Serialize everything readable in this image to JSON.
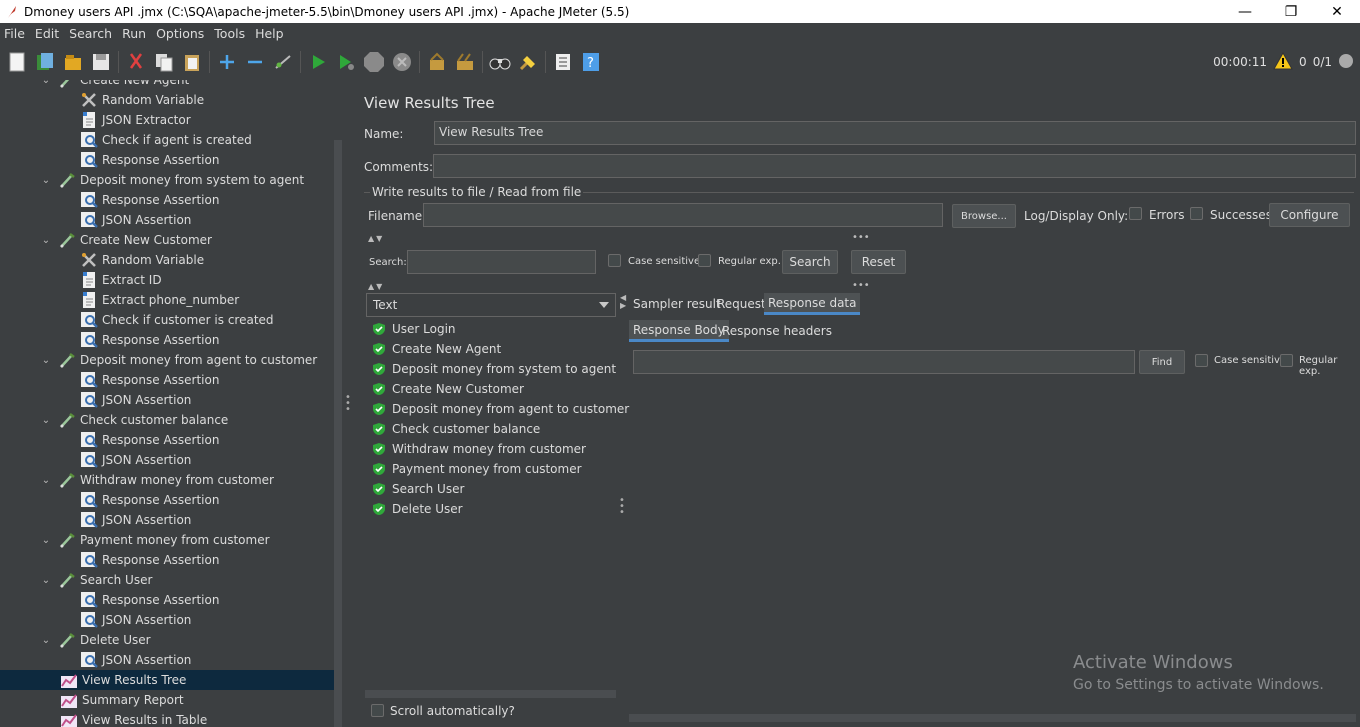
{
  "window": {
    "title": "Dmoney users API .jmx (C:\\SQA\\apache-jmeter-5.5\\bin\\Dmoney users API .jmx) - Apache JMeter (5.5)",
    "minimize": "—",
    "maximize": "❐",
    "close": "✕"
  },
  "menu": {
    "file": "File",
    "edit": "Edit",
    "search": "Search",
    "run": "Run",
    "options": "Options",
    "tools": "Tools",
    "help": "Help"
  },
  "toolbar": {
    "elapsed": "00:00:11",
    "errors": "0",
    "threads": "0/1"
  },
  "tree": {
    "items": [
      {
        "label": "Create New Agent",
        "icon": "sampler-icon",
        "level": 1
      },
      {
        "label": "Random Variable",
        "icon": "config-icon",
        "level": 2
      },
      {
        "label": "JSON Extractor",
        "icon": "extractor-icon",
        "level": 2
      },
      {
        "label": "Check if agent is created",
        "icon": "assertion-icon",
        "level": 2
      },
      {
        "label": "Response Assertion",
        "icon": "assertion-icon",
        "level": 2
      },
      {
        "label": "Deposit money from system to agent",
        "icon": "sampler-icon",
        "level": 1
      },
      {
        "label": "Response Assertion",
        "icon": "assertion-icon",
        "level": 2
      },
      {
        "label": "JSON Assertion",
        "icon": "assertion-icon",
        "level": 2
      },
      {
        "label": "Create New Customer",
        "icon": "sampler-icon",
        "level": 1
      },
      {
        "label": "Random Variable",
        "icon": "config-icon",
        "level": 2
      },
      {
        "label": "Extract ID",
        "icon": "extractor-icon",
        "level": 2
      },
      {
        "label": "Extract phone_number",
        "icon": "extractor-icon",
        "level": 2
      },
      {
        "label": "Check if customer is created",
        "icon": "assertion-icon",
        "level": 2
      },
      {
        "label": "Response Assertion",
        "icon": "assertion-icon",
        "level": 2
      },
      {
        "label": "Deposit money from agent to customer",
        "icon": "sampler-icon",
        "level": 1
      },
      {
        "label": "Response Assertion",
        "icon": "assertion-icon",
        "level": 2
      },
      {
        "label": "JSON Assertion",
        "icon": "assertion-icon",
        "level": 2
      },
      {
        "label": "Check customer balance",
        "icon": "sampler-icon",
        "level": 1
      },
      {
        "label": "Response Assertion",
        "icon": "assertion-icon",
        "level": 2
      },
      {
        "label": "JSON Assertion",
        "icon": "assertion-icon",
        "level": 2
      },
      {
        "label": "Withdraw money from customer",
        "icon": "sampler-icon",
        "level": 1
      },
      {
        "label": "Response Assertion",
        "icon": "assertion-icon",
        "level": 2
      },
      {
        "label": "JSON Assertion",
        "icon": "assertion-icon",
        "level": 2
      },
      {
        "label": "Payment money from customer",
        "icon": "sampler-icon",
        "level": 1
      },
      {
        "label": "Response Assertion",
        "icon": "assertion-icon",
        "level": 2
      },
      {
        "label": "Search User",
        "icon": "sampler-icon",
        "level": 1
      },
      {
        "label": "Response Assertion",
        "icon": "assertion-icon",
        "level": 2
      },
      {
        "label": "JSON Assertion",
        "icon": "assertion-icon",
        "level": 2
      },
      {
        "label": "Delete User",
        "icon": "sampler-icon",
        "level": 1
      },
      {
        "label": "JSON Assertion",
        "icon": "assertion-icon",
        "level": 2
      },
      {
        "label": "View Results Tree",
        "icon": "listener-icon",
        "level": 1,
        "selected": true
      },
      {
        "label": "Summary Report",
        "icon": "listener-icon",
        "level": 1
      },
      {
        "label": "View Results in Table",
        "icon": "listener-icon",
        "level": 1
      }
    ]
  },
  "panel": {
    "title": "View Results Tree",
    "name_label": "Name:",
    "name_value": "View Results Tree",
    "comments_label": "Comments:",
    "comments_value": "",
    "file_group_label": "Write results to file / Read from file",
    "filename_label": "Filename",
    "filename_value": "",
    "browse": "Browse...",
    "log_display_only": "Log/Display Only:",
    "errors": "Errors",
    "successes": "Successes",
    "configure": "Configure",
    "search_label": "Search:",
    "search_value": "",
    "case_sensitive": "Case sensitive",
    "regular_exp": "Regular exp.",
    "search_btn": "Search",
    "reset_btn": "Reset",
    "renderer": "Text",
    "scroll_automatically": "Scroll automatically?"
  },
  "results": [
    {
      "label": "User Login",
      "status": "success"
    },
    {
      "label": "Create New Agent",
      "status": "success"
    },
    {
      "label": "Deposit money from system to agent",
      "status": "success"
    },
    {
      "label": "Create New Customer",
      "status": "success"
    },
    {
      "label": "Deposit money from agent to customer",
      "status": "success"
    },
    {
      "label": "Check customer balance",
      "status": "success"
    },
    {
      "label": "Withdraw money from customer",
      "status": "success"
    },
    {
      "label": "Payment money from customer",
      "status": "success"
    },
    {
      "label": "Search User",
      "status": "success"
    },
    {
      "label": "Delete User",
      "status": "success"
    }
  ],
  "tabs": {
    "sampler_result": "Sampler result",
    "request": "Request",
    "response_data": "Response data",
    "response_body": "Response Body",
    "response_headers": "Response headers",
    "find_value": "",
    "find_btn": "Find",
    "case_sensitive": "Case sensitive",
    "regular_exp": "Regular exp."
  },
  "watermark": {
    "line1": "Activate Windows",
    "line2": "Go to Settings to activate Windows."
  },
  "colors": {
    "background": "#3c3f41",
    "selection": "#0d293e",
    "accent": "#4a88c7",
    "success": "#2fa83a"
  }
}
